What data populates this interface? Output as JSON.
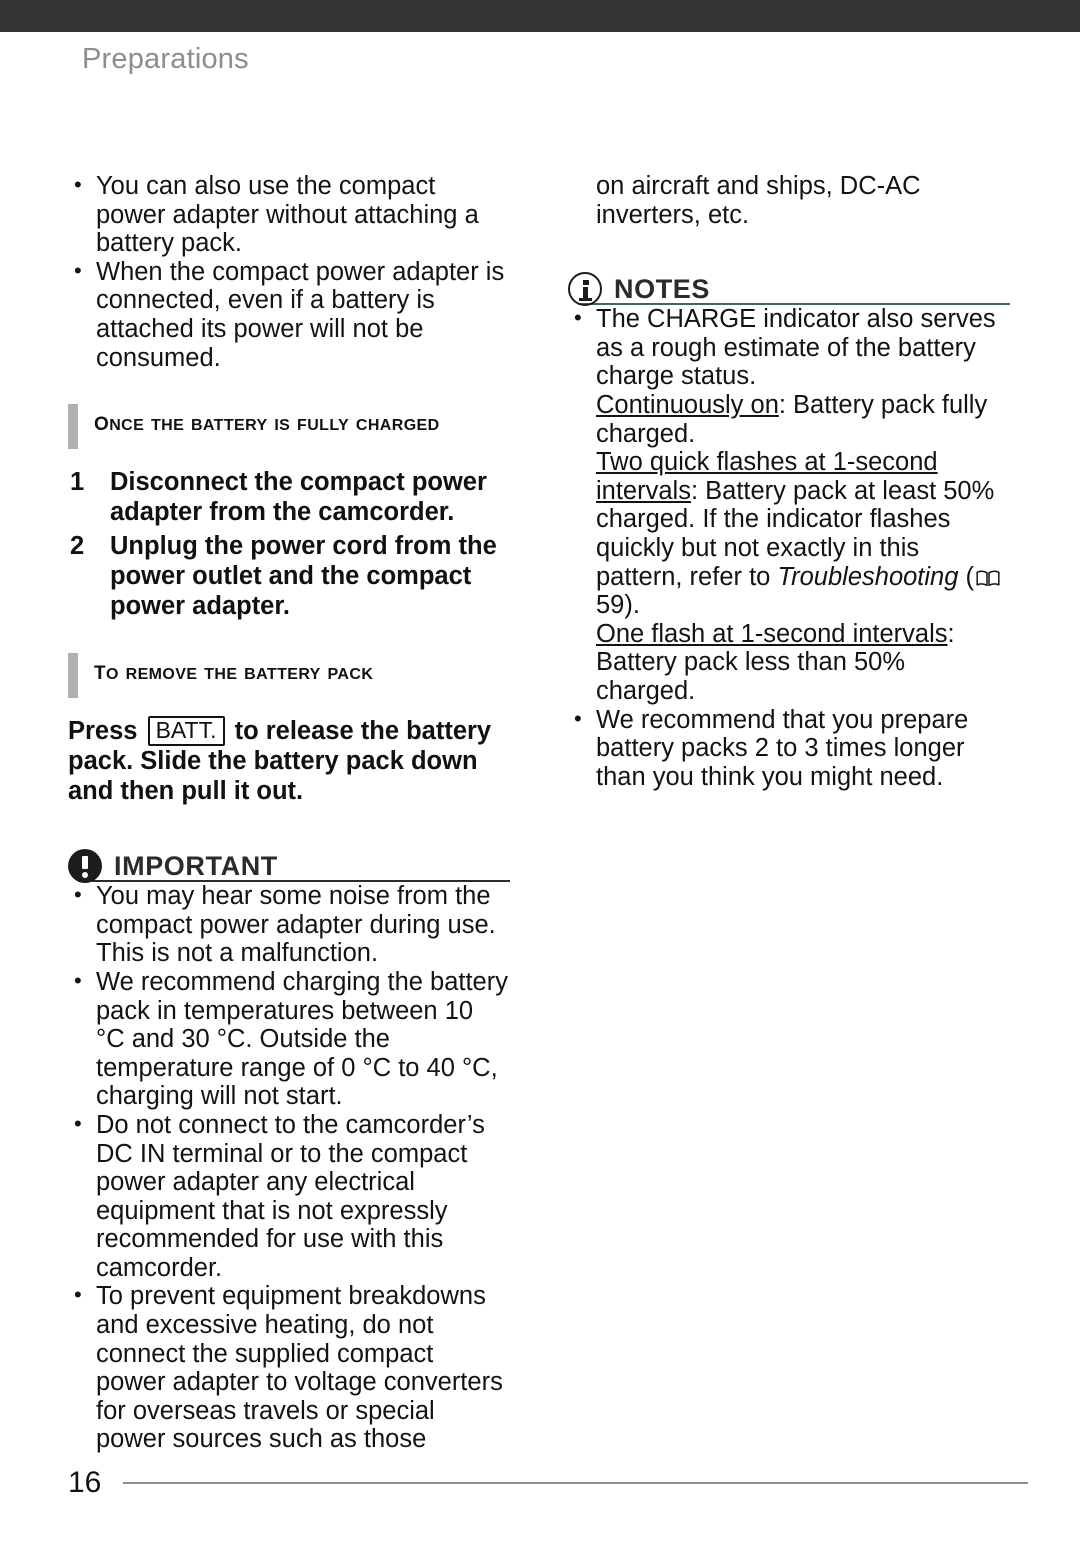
{
  "page": {
    "running_head": "Preparations",
    "folio": "16"
  },
  "left_column": {
    "intro_bullets": [
      "You can also use the compact power adapter without attaching a battery pack.",
      "When the compact power adapter is connected, even if a battery is attached its power will not be consumed."
    ],
    "section_charged": {
      "heading": "Once the battery is fully charged",
      "steps": [
        {
          "num": "1",
          "text": "Disconnect the compact power adapter from the camcorder."
        },
        {
          "num": "2",
          "text": "Unplug the power cord from the power outlet and the compact power adapter."
        }
      ]
    },
    "section_remove": {
      "heading": "To remove the battery pack",
      "instruction_before": "Press",
      "key_label": "BATT.",
      "instruction_after": "to release the battery pack. Slide the battery pack down and then pull it out."
    },
    "important": {
      "title": "IMPORTANT",
      "icon": "exclamation-circle-icon",
      "bullets": [
        "You may hear some noise from the compact power adapter during use. This is not a malfunction.",
        "We recommend charging the battery pack in temperatures between 10 °C and 30 °C. Outside the temperature range of 0 °C to 40 °C, charging will not start.",
        "Do not connect to the camcorder’s DC IN terminal or to the compact power adapter any electrical equipment that is not expressly recommended for use with this camcorder.",
        "To prevent equipment breakdowns and excessive heating, do not connect the supplied compact power adapter to voltage converters for overseas travels or special power sources such as those"
      ]
    }
  },
  "right_column": {
    "continuation": "on aircraft and ships, DC-AC inverters, etc.",
    "notes": {
      "title": "NOTES",
      "icon": "info-circle-icon",
      "rule_color": "#3f6b4f",
      "bullet1": {
        "intro": "The CHARGE indicator also serves as a rough estimate of the battery charge status.",
        "state1_label": "Continuously on",
        "state1_text": ": Battery pack fully charged.",
        "state2_label": "Two quick flashes at 1-second intervals",
        "state2_text": ": Battery pack at least 50% charged. If the indicator flashes quickly but not exactly in this pattern, refer to ",
        "reference_italic": "Troubleshooting",
        "reference_open": " (",
        "reference_icon": "open-book-icon",
        "reference_page": " 59).",
        "state3_label": "One flash at 1-second intervals",
        "state3_text": ": Battery pack less than 50% charged."
      },
      "bullet2": "We recommend that you prepare battery packs 2 to 3 times longer than you think you might need."
    }
  }
}
